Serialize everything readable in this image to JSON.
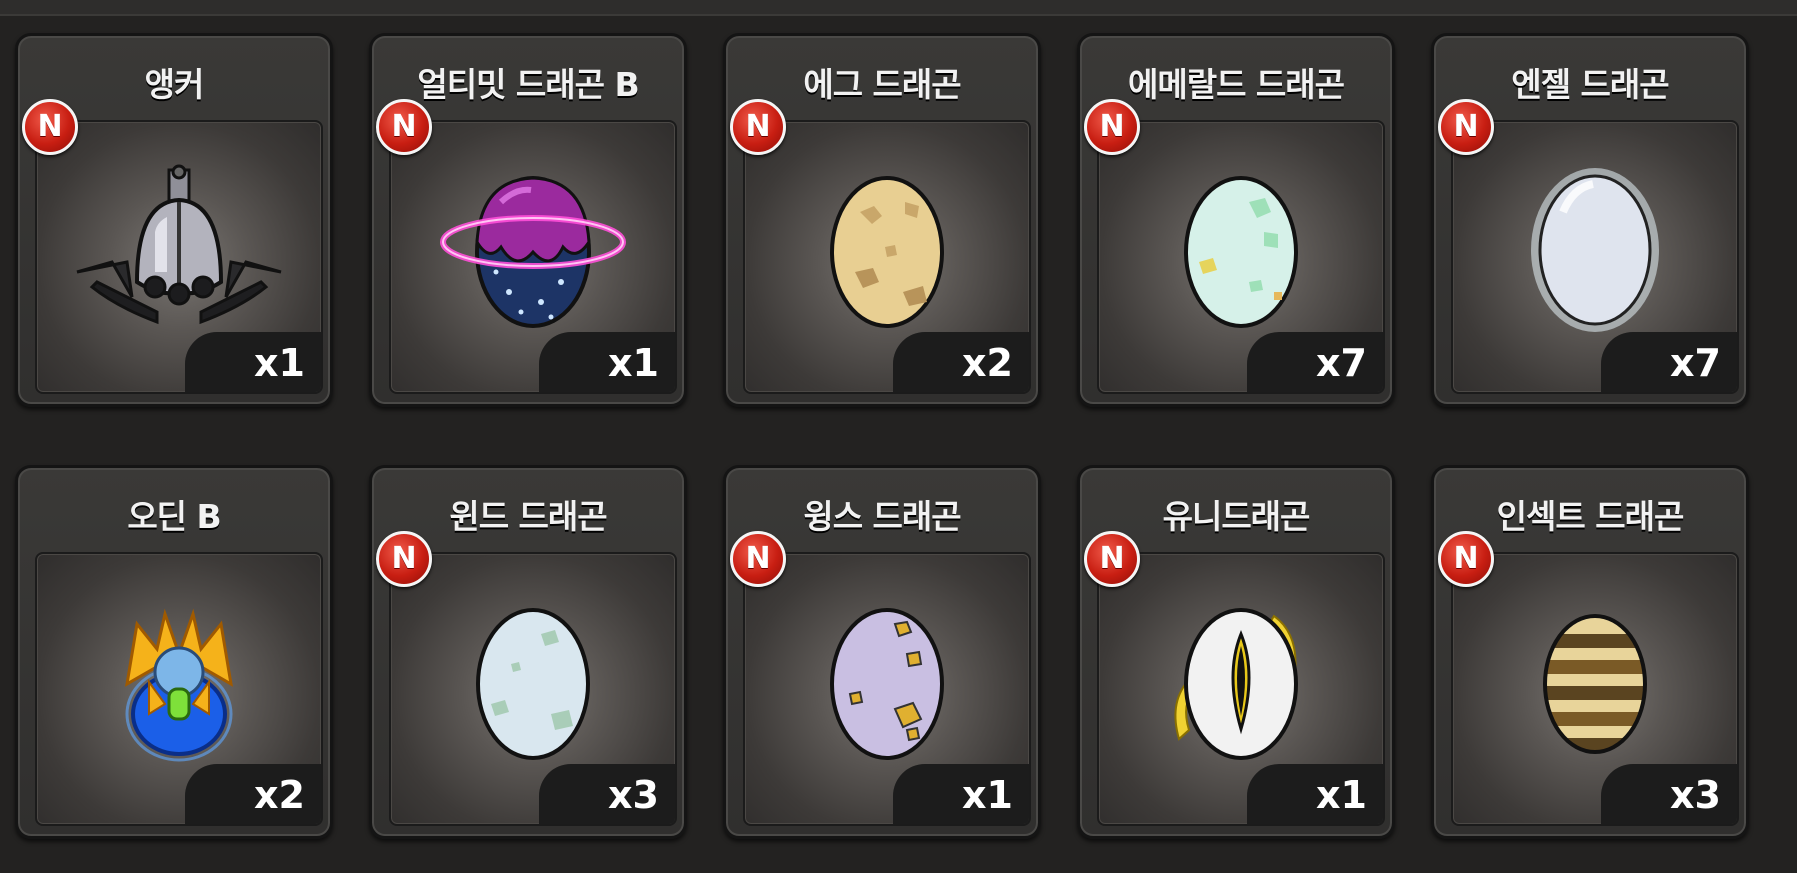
{
  "inventory": {
    "items": [
      {
        "name": "앵커",
        "count": "x1",
        "badge": "N"
      },
      {
        "name": "얼티밋 드래곤 B",
        "count": "x1",
        "badge": "N"
      },
      {
        "name": "에그 드래곤",
        "count": "x2",
        "badge": "N"
      },
      {
        "name": "에메랄드 드래곤",
        "count": "x7",
        "badge": "N"
      },
      {
        "name": "엔젤 드래곤",
        "count": "x7",
        "badge": "N"
      },
      {
        "name": "오딘 B",
        "count": "x2"
      },
      {
        "name": "윈드 드래곤",
        "count": "x3",
        "badge": "N"
      },
      {
        "name": "윙스 드래곤",
        "count": "x1",
        "badge": "N"
      },
      {
        "name": "유니드래곤",
        "count": "x1",
        "badge": "N"
      },
      {
        "name": "인섹트 드래곤",
        "count": "x3",
        "badge": "N"
      }
    ]
  },
  "icons": [
    "anchor-icon",
    "ultimate-dragon-egg-icon",
    "egg-dragon-egg-icon",
    "emerald-dragon-egg-icon",
    "angel-dragon-egg-icon",
    "odin-emblem-icon",
    "wind-dragon-egg-icon",
    "wings-dragon-egg-icon",
    "uni-dragon-egg-icon",
    "insect-dragon-egg-icon"
  ],
  "colors": {
    "badge_red": "#c81e12",
    "background": "#232221",
    "count_bg": "#1c1c1c"
  }
}
